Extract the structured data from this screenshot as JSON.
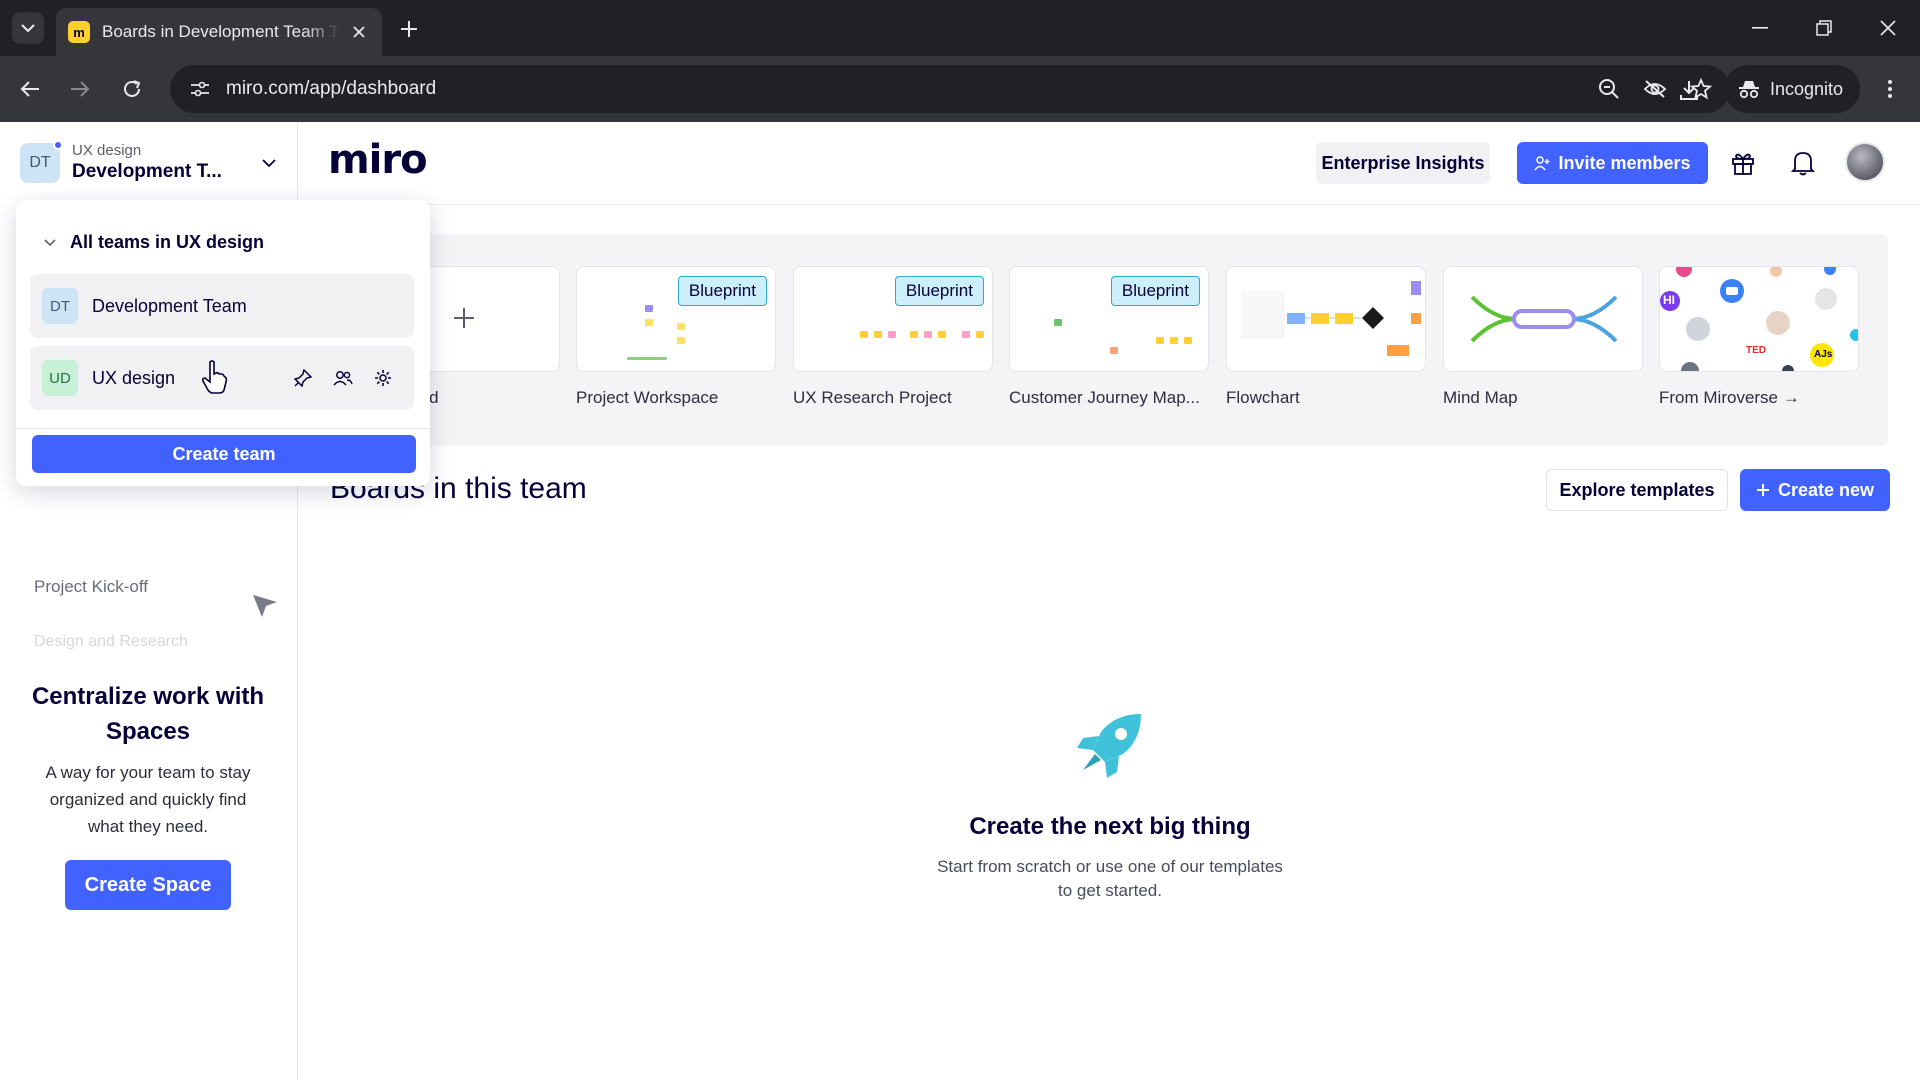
{
  "browser": {
    "tab_title": "Boards in Development Team Tea",
    "url": "miro.com/app/dashboard",
    "incognito_label": "Incognito"
  },
  "sidebar": {
    "org": "UX design",
    "team_name": "Development T...",
    "team_initials": "DT",
    "boards": [
      "Project Kick-off",
      "Design and Research"
    ],
    "promo": {
      "title": "Centralize work with Spaces",
      "text": "A way for your team to stay organized and quickly find what they need.",
      "button": "Create Space"
    }
  },
  "dropdown": {
    "header": "All teams in UX design",
    "teams": [
      {
        "initials": "DT",
        "name": "Development Team"
      },
      {
        "initials": "UD",
        "name": "UX design"
      }
    ],
    "create_team": "Create team"
  },
  "header": {
    "logo": "miro",
    "enterprise_insights": "Enterprise Insights",
    "invite_members": "Invite members"
  },
  "templates": {
    "partial_label": "ard",
    "items": [
      {
        "label": "Project Workspace",
        "badge": "Blueprint"
      },
      {
        "label": "UX Research Project",
        "badge": "Blueprint"
      },
      {
        "label": "Customer Journey Map...",
        "badge": "Blueprint"
      },
      {
        "label": "Flowchart",
        "badge": ""
      },
      {
        "label": "Mind Map",
        "badge": ""
      },
      {
        "label": "From Miroverse →",
        "badge": ""
      }
    ],
    "miroverse_ted": "TED",
    "miroverse_ajs": "AJs",
    "miroverse_hi": "HI"
  },
  "boards_section": {
    "title": "Boards in this team",
    "explore": "Explore templates",
    "create_new": "Create new"
  },
  "empty_state": {
    "title": "Create the next big thing",
    "text": "Start from scratch or use one of our templates to get started."
  },
  "colors": {
    "brand_blue": "#4262ff",
    "brand_yellow": "#ffd02f",
    "badge_bg": "#cdeefb"
  }
}
